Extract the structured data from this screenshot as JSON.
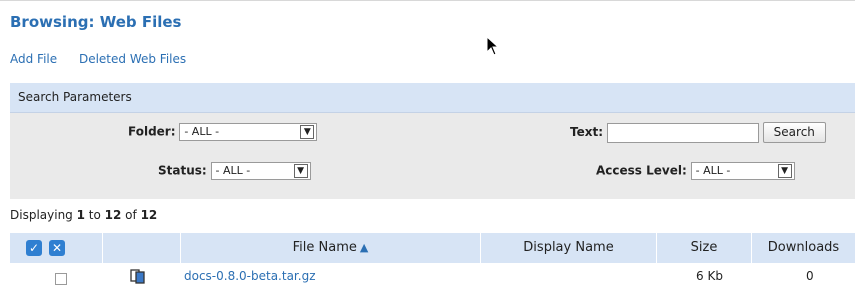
{
  "header": {
    "title": "Browsing: Web Files",
    "links": [
      "Add File",
      "Deleted Web Files"
    ]
  },
  "search": {
    "section_label": "Search Parameters",
    "folder_label": "Folder:",
    "folder_value": "- ALL -",
    "status_label": "Status:",
    "status_value": "- ALL -",
    "text_label": "Text:",
    "text_value": "",
    "search_button": "Search",
    "access_label": "Access Level:",
    "access_value": "- ALL -"
  },
  "results": {
    "displaying_prefix": "Displaying ",
    "from": "1",
    "to_word": " to ",
    "to": "12",
    "of_word": " of ",
    "total": "12"
  },
  "table": {
    "columns": [
      "File Name",
      "Display Name",
      "Size",
      "Downloads"
    ],
    "sorted_by": "File Name",
    "rows": [
      {
        "file_name": "docs-0.8.0-beta.tar.gz",
        "display_name": "",
        "size": "6 Kb",
        "downloads": "0"
      }
    ]
  },
  "icons": {
    "select_all": "check-icon",
    "deselect_all": "x-icon",
    "file_type": "file-icon",
    "sort": "sort-ascending-icon"
  }
}
